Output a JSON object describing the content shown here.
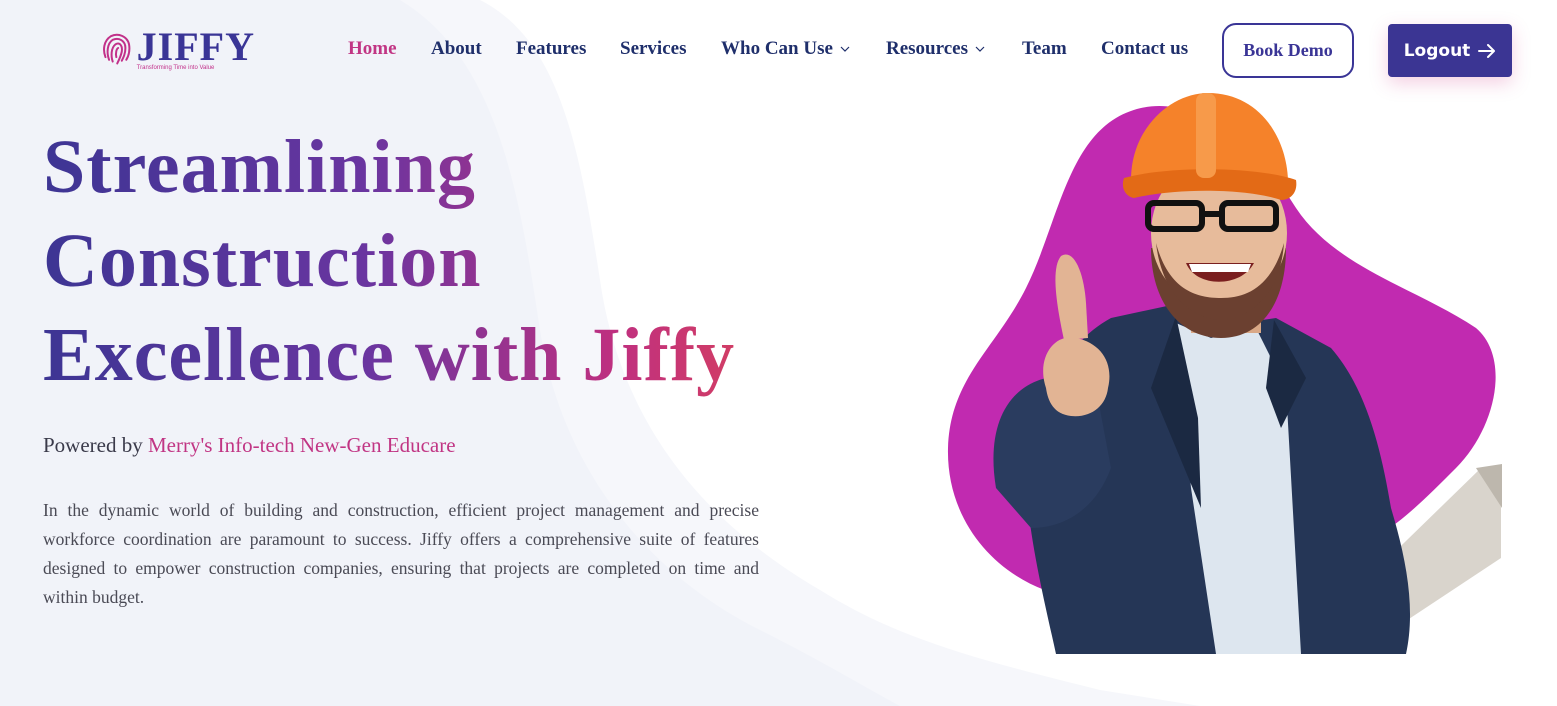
{
  "header": {
    "logo": {
      "name": "JIFFY",
      "tagline": "Transforming Time into Value"
    },
    "nav": [
      {
        "label": "Home",
        "active": true
      },
      {
        "label": "About",
        "active": false
      },
      {
        "label": "Features",
        "active": false
      },
      {
        "label": "Services",
        "active": false
      },
      {
        "label": "Who Can Use",
        "active": false,
        "dropdown": true
      },
      {
        "label": "Resources",
        "active": false,
        "dropdown": true
      },
      {
        "label": "Team",
        "active": false
      },
      {
        "label": "Contact us",
        "active": false
      }
    ],
    "book_demo_label": "Book Demo",
    "logout_label": "Logout"
  },
  "hero": {
    "title_lines": [
      "Streamlining",
      "Construction",
      "Excellence with Jiffy"
    ],
    "powered_prefix": "Powered by ",
    "powered_link": "Merry's Info-tech New-Gen Educare",
    "description": "In the dynamic world of building and construction, efficient project management and precise workforce coordination are paramount to success. Jiffy offers a comprehensive suite of features designed to empower construction companies, ensuring that projects are completed on time and within budget."
  },
  "colors": {
    "primary": "#3a3596",
    "accent": "#c13584",
    "nav_text": "#1f2f6b",
    "blob": "#c12ab0",
    "helmet": "#f5822a"
  },
  "icons": {
    "logo_mark": "fingerprint-icon",
    "dropdown": "chevron-down-icon",
    "logout": "arrow-right-icon"
  }
}
